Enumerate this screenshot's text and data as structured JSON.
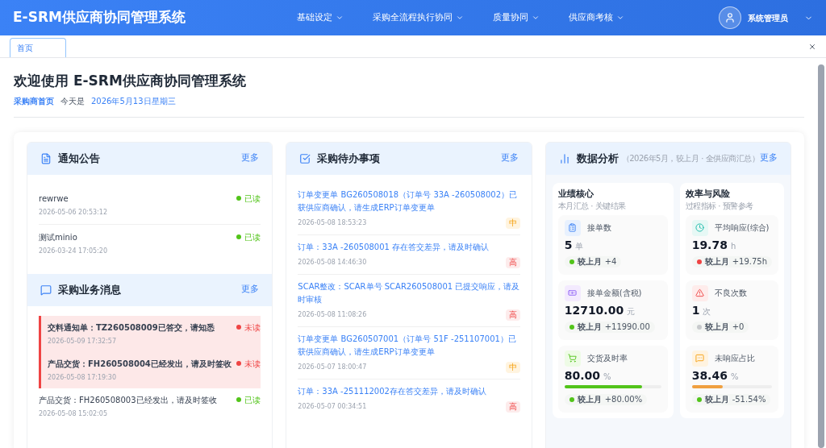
{
  "header": {
    "title": "E-SRM供应商协同管理系统",
    "menus": [
      "基础设定",
      "采购全流程执行协同",
      "质量协同",
      "供应商考核"
    ],
    "user": "系统管理员"
  },
  "tabs": [
    {
      "label": "首页",
      "selected": true
    }
  ],
  "welcome": {
    "title": "欢迎使用 E-SRM供应商协同管理系统",
    "breadcrumb": "采购商首页",
    "today_label": "今天是",
    "date": "2026年5月13日星期三"
  },
  "notices": {
    "title": "通知公告",
    "more": "更多",
    "items": [
      {
        "title": "rewrwe",
        "time": "2026-05-06 20:53:12",
        "status": "已读",
        "read": true
      },
      {
        "title": "测试minio",
        "time": "2026-03-24 17:05:20",
        "status": "已读",
        "read": true
      }
    ]
  },
  "messages": {
    "title": "采购业务消息",
    "more": "更多",
    "items": [
      {
        "title": "交料通知单：TZ260508009已答交，请知悉",
        "time": "2026-05-09 17:32:57",
        "status": "未读",
        "read": false
      },
      {
        "title": "产品交货：FH260508004已经发出，请及时签收",
        "time": "2026-05-08 17:19:30",
        "status": "未读",
        "read": false
      },
      {
        "title": "产品交货：FH260508003已经发出，请及时签收",
        "time": "2026-05-08 15:02:05",
        "status": "已读",
        "read": true
      }
    ]
  },
  "todos": {
    "title": "采购待办事项",
    "more": "更多",
    "items": [
      {
        "text": "订单变更单 BG260508018（订单号 33A -260508002）已获供应商确认，请生成ERP订单变更单",
        "time": "2026-05-08 18:53:23",
        "priority": "中",
        "kind": "medium"
      },
      {
        "text": "订单：33A -260508001 存在答交差异，请及时确认",
        "time": "2026-05-08 14:46:30",
        "priority": "高",
        "kind": "high"
      },
      {
        "text": "SCAR整改：SCAR单号 SCAR260508001 已提交响应，请及时审核",
        "time": "2026-05-08 11:08:26",
        "priority": "高",
        "kind": "high"
      },
      {
        "text": "订单变更单 BG260507001（订单号 51F -251107001）已获供应商确认，请生成ERP订单变更单",
        "time": "2026-05-07 18:00:47",
        "priority": "中",
        "kind": "medium"
      },
      {
        "text": "订单：33A -251112002存在答交差异，请及时确认",
        "time": "2026-05-07 00:34:51",
        "priority": "高",
        "kind": "high"
      }
    ]
  },
  "analysis": {
    "title": "数据分析",
    "subtitle": "（2026年5月，较上月 · 全供应商汇总）",
    "more": "更多",
    "groups": [
      {
        "title": "业绩核心",
        "subtitle": "本月汇总 · 关键结果",
        "metrics": [
          {
            "kind": "orders",
            "label": "接单数",
            "value": "5",
            "unit": "单",
            "trend_label": "较上月",
            "delta": "+4",
            "color": "#52c41a"
          },
          {
            "kind": "amount",
            "label": "接单金额(含税)",
            "value": "12710.00",
            "unit": "元",
            "trend_label": "较上月",
            "delta": "+11990.00",
            "color": "#52c41a"
          },
          {
            "kind": "delivery",
            "label": "交货及时率",
            "value": "80.00",
            "unit": "%",
            "level": 0.8,
            "trend_label": "较上月",
            "delta": "+80.00%",
            "color": "#52c41a"
          }
        ]
      },
      {
        "title": "效率与风险",
        "subtitle": "过程指标 · 预警参考",
        "metrics": [
          {
            "kind": "response",
            "label": "平均响应(综合)",
            "value": "19.78",
            "unit": "h",
            "trend_label": "较上月",
            "delta": "+19.75h",
            "color": "#ef4444"
          },
          {
            "kind": "defects",
            "label": "不良次数",
            "value": "1",
            "unit": "次",
            "trend_label": "较上月",
            "delta": "+0",
            "color": "#c7c9cc"
          },
          {
            "kind": "unanswered",
            "label": "未响应占比",
            "value": "38.46",
            "unit": "%",
            "level": 0.3846,
            "trend_label": "较上月",
            "delta": "-51.54%",
            "color": "#52c41a"
          }
        ]
      }
    ]
  }
}
